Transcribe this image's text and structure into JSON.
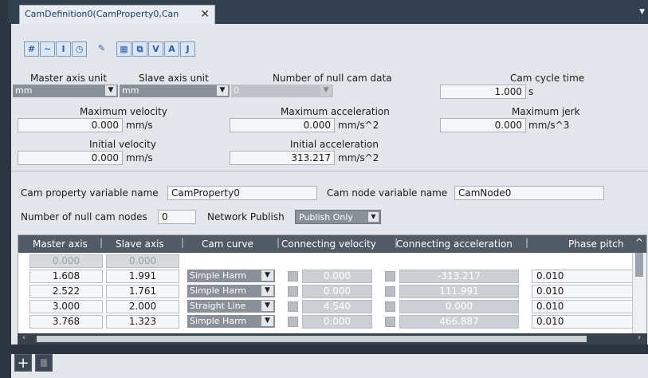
{
  "tab": {
    "title": "CamDefinition0(CamProperty0,Can"
  },
  "toolbar": {
    "buttons": [
      "grid-icon",
      "curve-icon",
      "text-icon",
      "clock-icon",
      "wrench-icon",
      "table-icon",
      "copy-icon",
      "vertical-icon",
      "acceleration-icon",
      "jerk-icon"
    ]
  },
  "settings": {
    "master_axis_unit_label": "Master axis unit",
    "master_axis_unit_value": "mm",
    "slave_axis_unit_label": "Slave axis unit",
    "slave_axis_unit_value": "mm",
    "null_cam_label": "Number of null cam data",
    "null_cam_value": "0",
    "cycle_time_label": "Cam cycle time",
    "cycle_time_value": "1.000",
    "cycle_time_unit": "s",
    "max_velocity_label": "Maximum velocity",
    "max_velocity_value": "0.000",
    "max_velocity_unit": "mm/s",
    "max_accel_label": "Maximum acceleration",
    "max_accel_value": "0.000",
    "max_accel_unit": "mm/s^2",
    "max_jerk_label": "Maximum jerk",
    "max_jerk_value": "0.000",
    "max_jerk_unit": "mm/s^3",
    "init_velocity_label": "Initial velocity",
    "init_velocity_value": "0.000",
    "init_velocity_unit": "mm/s",
    "init_accel_label": "Initial acceleration",
    "init_accel_value": "313.217",
    "init_accel_unit": "mm/s^2"
  },
  "variables": {
    "cam_property_label": "Cam property variable name",
    "cam_property_value": "CamProperty0",
    "cam_node_label": "Cam node variable name",
    "cam_node_value": "CamNode0",
    "null_nodes_label": "Number of null cam nodes",
    "null_nodes_value": "0",
    "network_publish_label": "Network Publish",
    "network_publish_value": "Publish Only"
  },
  "table": {
    "headers": [
      "Master axis",
      "Slave axis",
      "Cam curve",
      "Connecting velocity",
      "Connecting acceleration",
      "Phase pitch"
    ],
    "rows": [
      {
        "master": "0.000",
        "slave": "0.000",
        "curve": "",
        "velocity": "",
        "accel": "",
        "pitch": ""
      },
      {
        "master": "1.608",
        "slave": "1.991",
        "curve": "Simple Harm",
        "velocity": "0.000",
        "accel": "-313.217",
        "pitch": "0.010"
      },
      {
        "master": "2.522",
        "slave": "1.761",
        "curve": "Simple Harm",
        "velocity": "0.000",
        "accel": "111.991",
        "pitch": "0.010"
      },
      {
        "master": "3.000",
        "slave": "2.000",
        "curve": "Straight Line",
        "velocity": "4.540",
        "accel": "0.000",
        "pitch": "0.010"
      },
      {
        "master": "3.768",
        "slave": "1.323",
        "curve": "Simple Harm",
        "velocity": "0.000",
        "accel": "466.887",
        "pitch": "0.010"
      }
    ]
  }
}
